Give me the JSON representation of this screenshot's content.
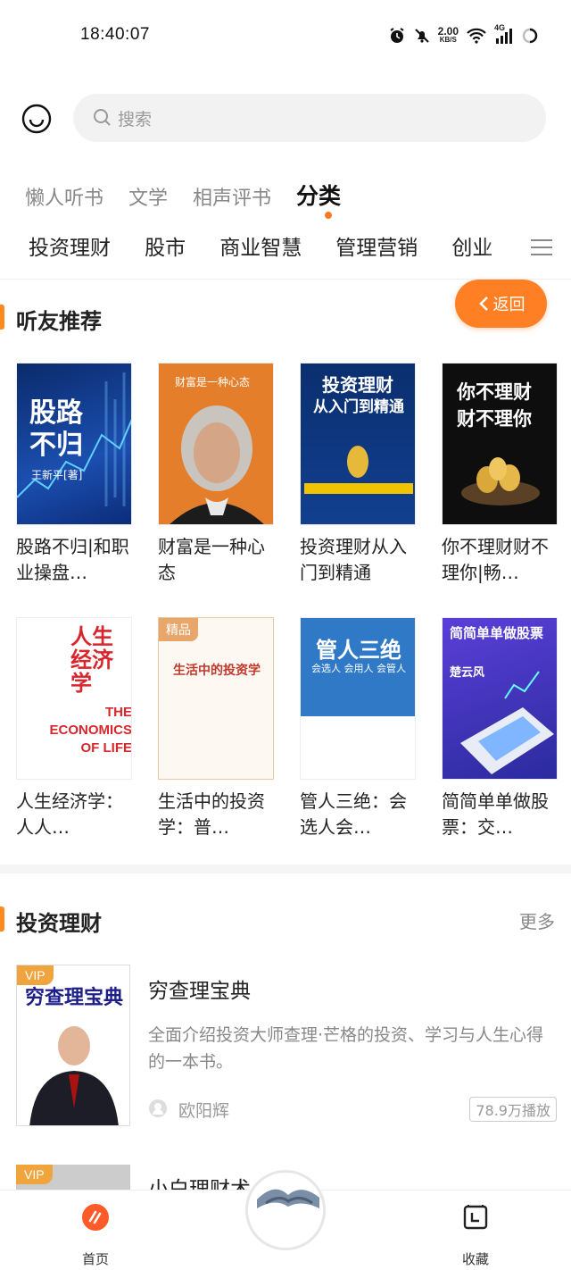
{
  "status_bar": {
    "time": "18:40:07",
    "net_speed_value": "2.00",
    "net_speed_unit": "KB/S",
    "network_label": "4G",
    "icons": [
      "alarm-icon",
      "mute-icon",
      "wifi-icon",
      "signal-icon",
      "battery-icon"
    ]
  },
  "header": {
    "search_placeholder": "搜索"
  },
  "top_tabs": [
    {
      "label": "懒人听书",
      "active": false
    },
    {
      "label": "文学",
      "active": false
    },
    {
      "label": "相声评书",
      "active": false
    },
    {
      "label": "分类",
      "active": true
    }
  ],
  "categories": [
    "投资理财",
    "股市",
    "商业智慧",
    "管理营销",
    "创业"
  ],
  "recommend": {
    "title": "听友推荐",
    "back_label": "返回",
    "books": [
      {
        "title": "股路不归|和职业操盘…",
        "cover_text": "股路不归",
        "cover_sub": "王新平[著]"
      },
      {
        "title": "财富是一种心态",
        "cover_text": "财富是一种心态",
        "cover_sub": ""
      },
      {
        "title": "投资理财从入门到精通",
        "cover_text": "投资理财",
        "cover_sub": "从入门到精通"
      },
      {
        "title": "你不理财财不理你|畅…",
        "cover_text": "你不理财",
        "cover_sub": "财不理你"
      },
      {
        "title": "人生经济学：人人…",
        "cover_text": "人生经济学",
        "cover_sub": "THE ECONOMICS OF LIFE"
      },
      {
        "title": "生活中的投资学：普…",
        "cover_text": "生活中的投资学",
        "cover_sub": "精品"
      },
      {
        "title": "管人三绝：会选人会…",
        "cover_text": "管人三绝",
        "cover_sub": "会选人 会用人 会管人"
      },
      {
        "title": "简简单单做股票：交…",
        "cover_text": "简简单单做股票",
        "cover_sub": "楚云风"
      }
    ]
  },
  "invest_section": {
    "title": "投资理财",
    "more_label": "更多",
    "items": [
      {
        "vip": "VIP",
        "title": "穷查理宝典",
        "cover_text": "穷查理宝典",
        "desc": "全面介绍投资大师查理·芒格的投资、学习与人生心得的一本书。",
        "author": "欧阳辉",
        "plays": "78.9万播放"
      },
      {
        "vip": "VIP",
        "title": "小白理财术",
        "cover_text": ""
      }
    ]
  },
  "bottom_nav": {
    "home_label": "首页",
    "fav_label": "收藏"
  },
  "colors": {
    "accent": "#ff7f24",
    "vip": "#f0a43d"
  }
}
